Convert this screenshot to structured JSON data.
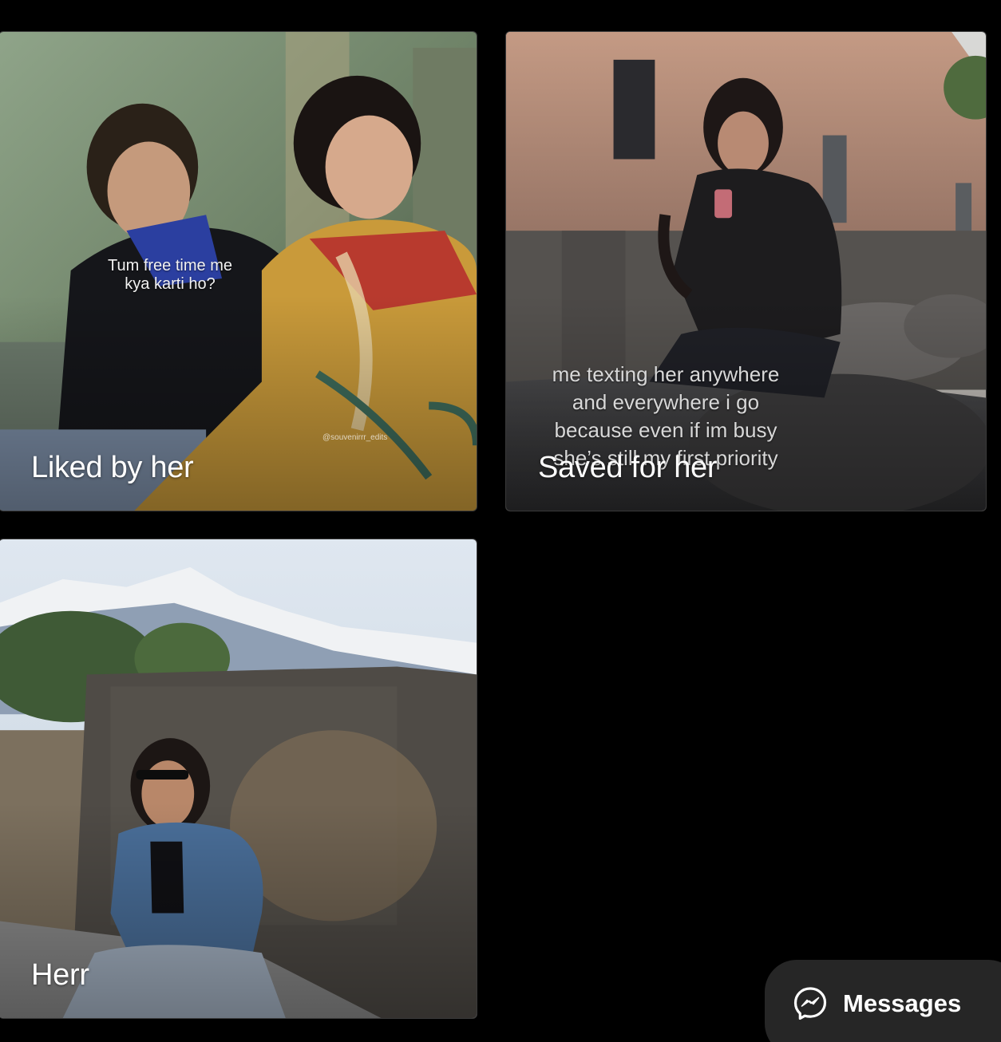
{
  "tiles": [
    {
      "label": "Liked by her",
      "caption": "Tum free time me\nkya karti ho?",
      "watermark": "@souvenirrr_edits"
    },
    {
      "label": "Saved for her",
      "caption": "me texting her anywhere\nand everywhere i go\nbecause even if im busy\nshe’s still my first priority"
    },
    {
      "label": "Herr"
    }
  ],
  "messages_button": {
    "label": "Messages",
    "icon": "messenger-icon"
  },
  "colors": {
    "background": "#000000",
    "button_bg": "#262626",
    "text": "#ffffff"
  }
}
